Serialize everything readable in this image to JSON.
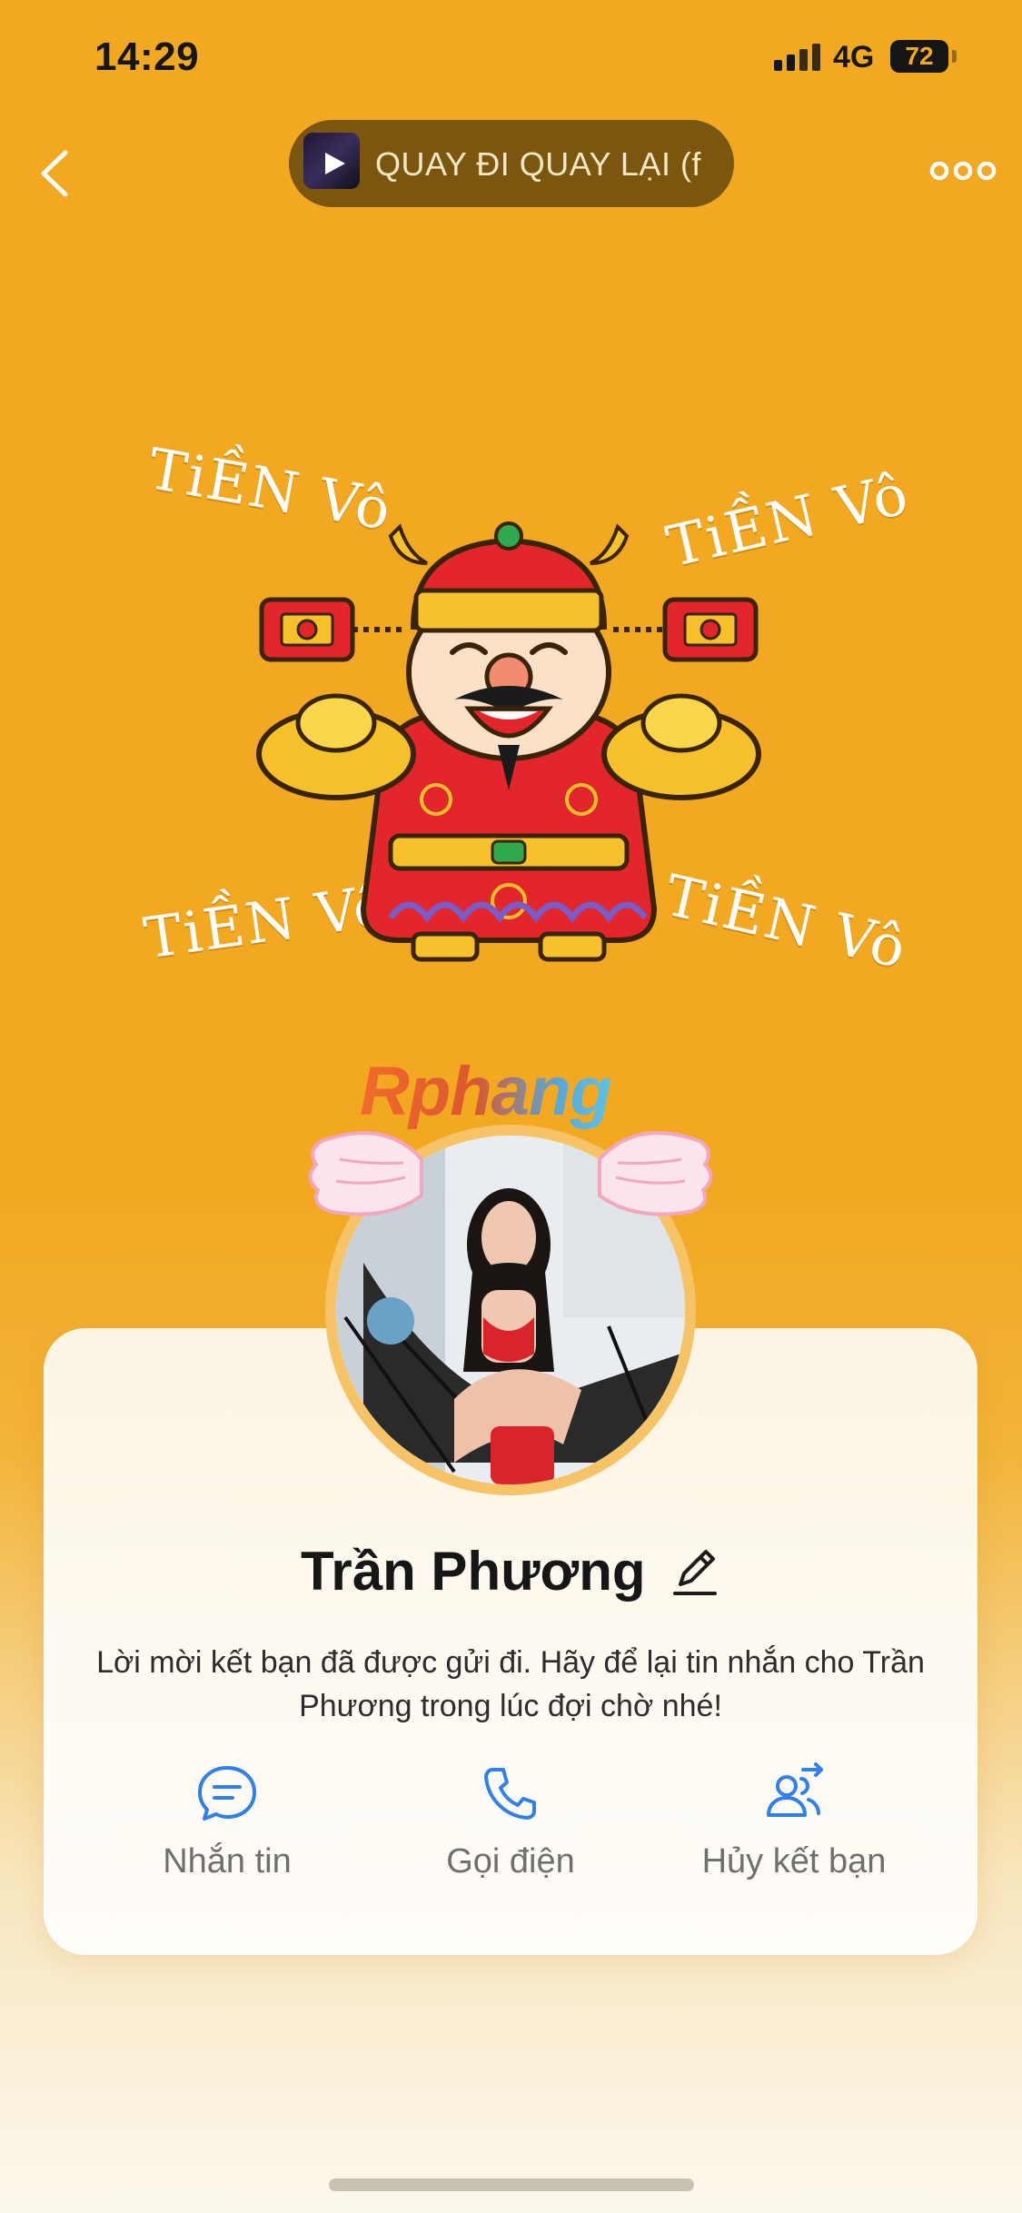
{
  "status_bar": {
    "time": "14:29",
    "network": "4G",
    "battery": "72"
  },
  "header": {
    "back_icon": "chevron-left-icon",
    "now_playing": "QUAY ĐI QUAY LẠI (f",
    "more_icon": "more-dots-icon"
  },
  "cover": {
    "sticker_text": "TiỀN Vô",
    "watermark": "Rphang"
  },
  "profile": {
    "name": "Trần Phương",
    "friend_request_message": "Lời mời kết bạn đã được gửi đi. Hãy để lại tin nhắn cho Trần Phương trong lúc đợi chờ nhé!"
  },
  "actions": [
    {
      "label": "Nhắn tin",
      "icon": "chat-bubble-icon"
    },
    {
      "label": "Gọi điện",
      "icon": "phone-icon"
    },
    {
      "label": "Hủy kết bạn",
      "icon": "cancel-friend-icon"
    }
  ],
  "colors": {
    "background": "#F2A821",
    "accent_blue": "#2F80ED",
    "card": "#FEF8EC"
  }
}
